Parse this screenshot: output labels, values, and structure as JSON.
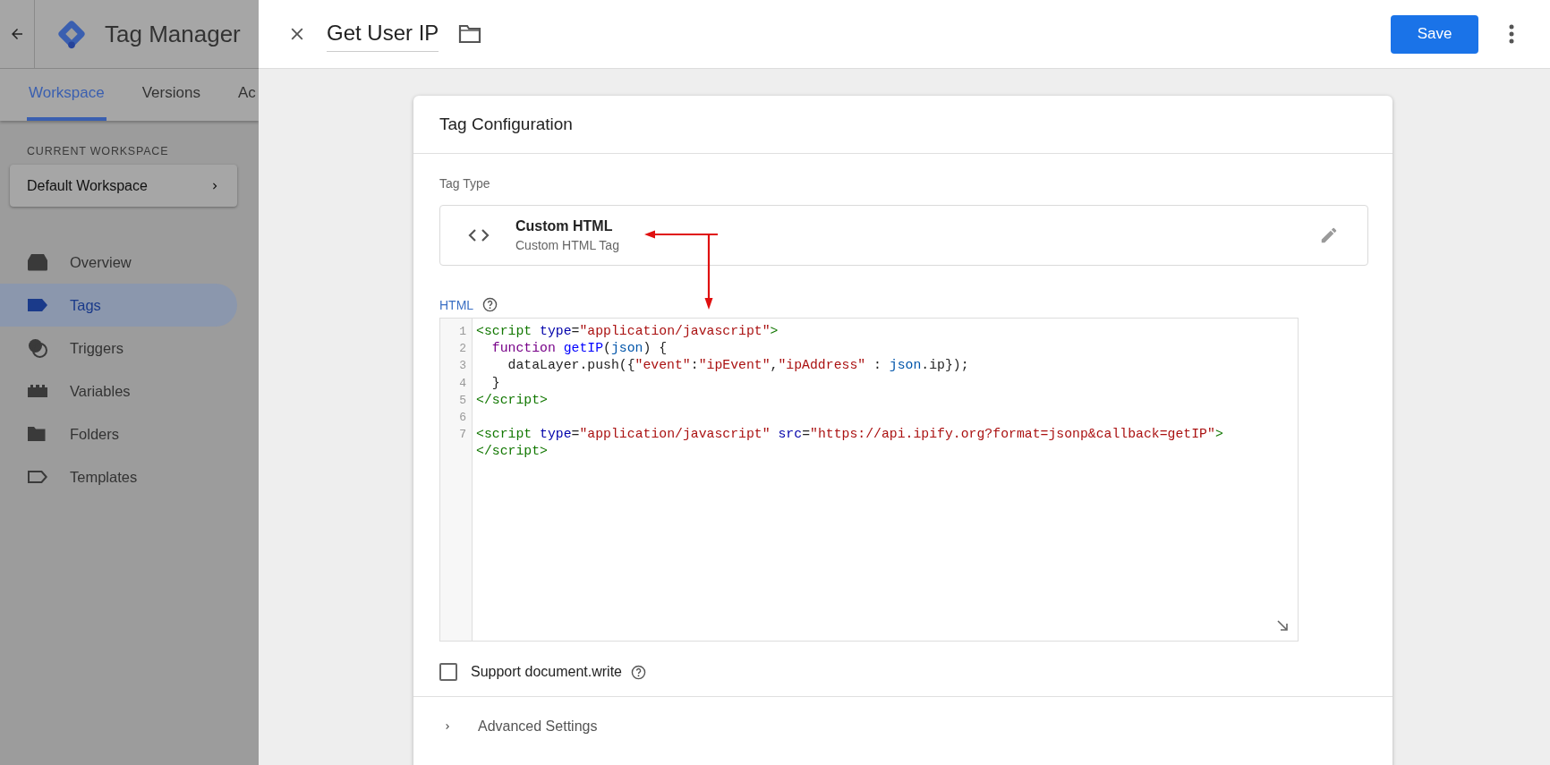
{
  "app": {
    "title": "Tag Manager"
  },
  "tabs": [
    {
      "label": "Workspace",
      "selected": true
    },
    {
      "label": "Versions",
      "selected": false
    },
    {
      "label": "Ac",
      "selected": false
    }
  ],
  "workspace": {
    "label": "CURRENT WORKSPACE",
    "name": "Default Workspace"
  },
  "nav": [
    {
      "label": "Overview",
      "kind": "overview",
      "selected": false
    },
    {
      "label": "Tags",
      "kind": "tags",
      "selected": true
    },
    {
      "label": "Triggers",
      "kind": "triggers",
      "selected": false
    },
    {
      "label": "Variables",
      "kind": "variables",
      "selected": false
    },
    {
      "label": "Folders",
      "kind": "folders",
      "selected": false
    },
    {
      "label": "Templates",
      "kind": "templates",
      "selected": false
    }
  ],
  "panel": {
    "title": "Get User IP",
    "save": "Save"
  },
  "card": {
    "title": "Tag Configuration",
    "tag_type_label": "Tag Type",
    "tag_type": {
      "name": "Custom HTML",
      "description": "Custom HTML Tag"
    },
    "html_label": "HTML",
    "code": [
      {
        "number": "1",
        "tokens": [
          {
            "kind": "tag",
            "text": "<script"
          },
          {
            "kind": "attr",
            "text": " type"
          },
          {
            "kind": "plain",
            "text": "="
          },
          {
            "kind": "string",
            "text": "\"application/javascript\""
          },
          {
            "kind": "tag",
            "text": ">"
          }
        ]
      },
      {
        "number": "2",
        "tokens": [
          {
            "kind": "keyword",
            "text": "  function"
          },
          {
            "kind": "def",
            "text": " getIP"
          },
          {
            "kind": "plain",
            "text": "("
          },
          {
            "kind": "variable",
            "text": "json"
          },
          {
            "kind": "plain",
            "text": ") {"
          }
        ]
      },
      {
        "number": "3",
        "tokens": [
          {
            "kind": "plain",
            "text": "    dataLayer.push({"
          },
          {
            "kind": "string",
            "text": "\"event\""
          },
          {
            "kind": "plain",
            "text": ":"
          },
          {
            "kind": "string",
            "text": "\"ipEvent\""
          },
          {
            "kind": "plain",
            "text": ","
          },
          {
            "kind": "string",
            "text": "\"ipAddress\""
          },
          {
            "kind": "plain",
            "text": " : "
          },
          {
            "kind": "variable",
            "text": "json"
          },
          {
            "kind": "plain",
            "text": ".ip});"
          }
        ]
      },
      {
        "number": "4",
        "tokens": [
          {
            "kind": "plain",
            "text": "  }"
          }
        ]
      },
      {
        "number": "5",
        "tokens": [
          {
            "kind": "tag",
            "text": "</script>"
          }
        ]
      },
      {
        "number": "6"
      },
      {
        "number": "7",
        "tokens": [
          {
            "kind": "tag",
            "text": "<script"
          },
          {
            "kind": "attr",
            "text": " type"
          },
          {
            "kind": "plain",
            "text": "="
          },
          {
            "kind": "string",
            "text": "\"application/javascript\""
          },
          {
            "kind": "attr",
            "text": " src"
          },
          {
            "kind": "plain",
            "text": "="
          },
          {
            "kind": "string",
            "text": "\"https://api.ipify.org?format=jsonp&callback=getIP\""
          },
          {
            "kind": "tag",
            "text": ">"
          }
        ]
      },
      {
        "tokens": [
          {
            "kind": "tag",
            "text": "</script>"
          }
        ]
      }
    ],
    "support_document_write": {
      "label": "Support document.write",
      "checked": false
    },
    "advanced": {
      "label": "Advanced Settings",
      "expanded": false
    }
  }
}
